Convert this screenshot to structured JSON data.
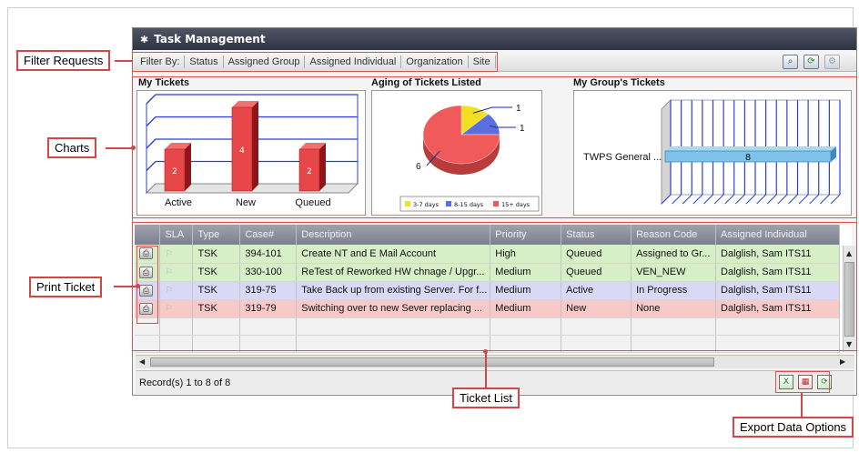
{
  "window": {
    "title": "Task Management"
  },
  "filterbar": {
    "items": [
      "Filter By:",
      "Status",
      "Assigned Group",
      "Assigned Individual",
      "Organization",
      "Site"
    ]
  },
  "toolbar_icons": [
    "search-icon",
    "refresh-icon",
    "settings-icon"
  ],
  "charts": {
    "my_tickets_title": "My Tickets",
    "aging_title": "Aging of Tickets Listed",
    "group_title": "My Group's Tickets"
  },
  "chart_data": [
    {
      "type": "bar",
      "title": "My Tickets",
      "categories": [
        "Active",
        "New",
        "Queued"
      ],
      "values": [
        2,
        4,
        2
      ],
      "ylim": [
        0,
        4
      ],
      "grid": true,
      "color": "#e8474a"
    },
    {
      "type": "pie",
      "title": "Aging of Tickets Listed",
      "categories": [
        "3-7 days",
        "8-15 days",
        "15+ days"
      ],
      "values": [
        1,
        1,
        6
      ],
      "colors": [
        "#f0e020",
        "#5a6ee0",
        "#f05a5a"
      ],
      "legend": "bottom"
    },
    {
      "type": "bar",
      "title": "My Group's Tickets",
      "orientation": "horizontal",
      "categories": [
        "TWPS General ..."
      ],
      "values": [
        8
      ],
      "color": "#7fc3ea",
      "grid": true
    }
  ],
  "grid": {
    "columns": [
      "",
      "SLA",
      "Type",
      "Case#",
      "Description",
      "Priority",
      "Status",
      "Reason Code",
      "Assigned Individual"
    ],
    "rows": [
      {
        "type": "TSK",
        "case": "394-101",
        "description": "Create NT and E Mail Account",
        "priority": "High",
        "status": "Queued",
        "reason": "Assigned to Gr...",
        "assigned": "Dalglish, Sam ITS11"
      },
      {
        "type": "TSK",
        "case": "330-100",
        "description": "ReTest of Reworked HW chnage / Upgr...",
        "priority": "Medium",
        "status": "Queued",
        "reason": "VEN_NEW",
        "assigned": "Dalglish, Sam ITS11"
      },
      {
        "type": "TSK",
        "case": "319-75",
        "description": "Take Back up from existing Server. For f...",
        "priority": "Medium",
        "status": "Active",
        "reason": "In Progress",
        "assigned": "Dalglish, Sam ITS11"
      },
      {
        "type": "TSK",
        "case": "319-79",
        "description": "Switching over to new Sever replacing ...",
        "priority": "Medium",
        "status": "New",
        "reason": "None",
        "assigned": "Dalglish, Sam ITS11"
      }
    ]
  },
  "status": {
    "records": "Record(s) 1 to 8 of 8"
  },
  "export_icons": [
    "excel-icon",
    "calendar-icon",
    "refresh-icon"
  ],
  "callouts": {
    "filter_requests": "Filter Requests",
    "charts": "Charts",
    "print_ticket": "Print Ticket",
    "ticket_list": "Ticket List",
    "export_data": "Export Data Options"
  }
}
